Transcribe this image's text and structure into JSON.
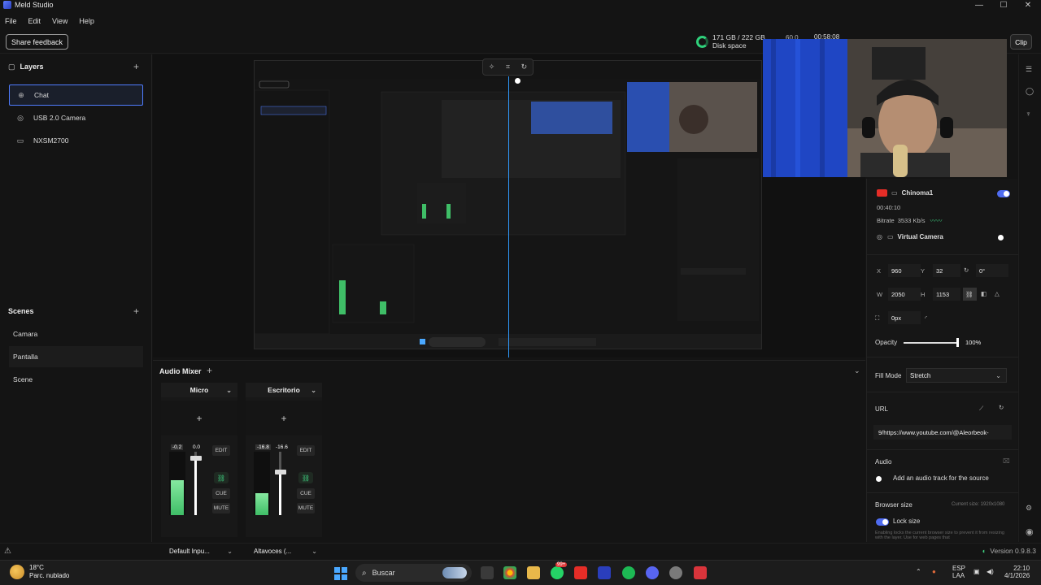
{
  "window": {
    "title": "Meld Studio",
    "min": "—",
    "max": "☐",
    "close": "✕"
  },
  "menu": [
    "File",
    "Edit",
    "View",
    "Help"
  ],
  "toolbar": {
    "feedback": "Share feedback",
    "disk_value": "171 GB / 222 GB",
    "disk_label": "Disk space",
    "fps": "60.0",
    "timer": "00:58:08",
    "clip": "Clip"
  },
  "layers": {
    "title": "Layers",
    "add": "+",
    "items": [
      {
        "label": "Chat",
        "icon": "globe-icon",
        "selected": true
      },
      {
        "label": "USB 2.0 Camera",
        "icon": "camera-icon"
      },
      {
        "label": "NXSM2700",
        "icon": "monitor-icon"
      }
    ]
  },
  "scenes": {
    "title": "Scenes",
    "add": "+",
    "items": [
      "Camara",
      "Pantalla",
      "Scene"
    ],
    "selected": "Pantalla"
  },
  "mixer": {
    "title": "Audio Mixer",
    "add": "+",
    "collapse": "⌄",
    "strips": [
      {
        "name": "Micro",
        "add": "+",
        "peak": "-0.2",
        "gain": "0.0",
        "edit": "EDIT",
        "cue": "CUE",
        "mute": "MUTE",
        "output": "Default Inpu...",
        "level": 0.55,
        "fader": 0.9,
        "scale": [
          "-30-",
          "-36-",
          "-42-",
          "-48-",
          "-54-"
        ]
      },
      {
        "name": "Escritorio",
        "add": "+",
        "peak": "-16.8",
        "gain": "-16.6",
        "edit": "EDIT",
        "cue": "CUE",
        "mute": "MUTE",
        "output": "Altavoces (...",
        "level": 0.35,
        "fader": 0.68,
        "scale": [
          "-30-",
          "-36-",
          "-42-",
          "-48-",
          "-54-"
        ]
      }
    ]
  },
  "outputs": {
    "stream_name": "Chinoma1",
    "stream_time": "00:40:10",
    "bitrate_label": "Bitrate",
    "bitrate_value": "3533 Kb/s",
    "virtual_camera": "Virtual Camera"
  },
  "properties": {
    "x_label": "X",
    "x": "960",
    "y_label": "Y",
    "y": "32",
    "rotation": "0°",
    "w_label": "W",
    "w": "2050",
    "h_label": "H",
    "h": "1153",
    "crop": "0px",
    "opacity_label": "Opacity",
    "opacity": "100%",
    "opacity_value": 1.0,
    "fill_mode_label": "Fill Mode",
    "fill_mode": "Stretch",
    "url_label": "URL",
    "url": "9/https://www.youtube.com/@Aleorbeok-",
    "audio_label": "Audio",
    "audio_hint": "Add an audio track for the source",
    "browser_size_label": "Browser size",
    "current_size": "Current size: 1920x1080",
    "lock_size": "Lock size",
    "lock_hint": "Enabling locks the current browser size to prevent it from resizing with the layer. Use for web pages that"
  },
  "status": {
    "version": "Version 0.9.8.3"
  },
  "taskbar": {
    "temp": "18°C",
    "weather": "Parc. nublado",
    "search": "Buscar",
    "lang1": "ESP",
    "lang2": "LAA",
    "time": "22:10",
    "date": "4/1/2026",
    "badge": "99+"
  },
  "colors": {
    "accent": "#4f7cff",
    "meter": "#3fbe67",
    "playhead": "#2f9bff",
    "toggle": "#4f6cf0"
  }
}
